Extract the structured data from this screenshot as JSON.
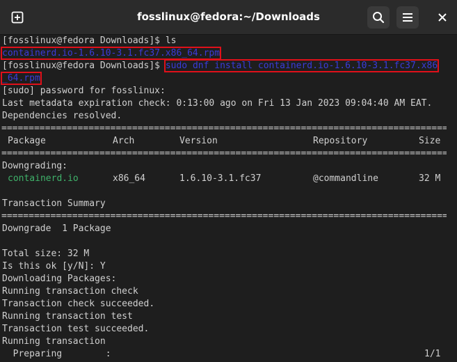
{
  "window": {
    "title": "fosslinux@fedora:~/Downloads",
    "icons": [
      "new-tab-icon",
      "search-icon",
      "hamburger-menu-icon",
      "close-icon"
    ]
  },
  "terminal": {
    "prompt": "[fosslinux@fedora Downloads]$ ",
    "cmd1": "ls",
    "ls_output": "containerd.io-1.6.10-3.1.fc37.x86_64.rpm",
    "cmd2_part1": "sudo dnf install containerd.io-1.6.10-3.1.fc37.x86",
    "cmd2_part2": "_64.rpm",
    "sudo_prompt": "[sudo] password for fosslinux:",
    "metadata": "Last metadata expiration check: 0:13:00 ago on Fri 13 Jan 2023 09:04:40 AM EAT.",
    "deps": "Dependencies resolved.",
    "rule": "================================================================================================",
    "table": {
      "headers": [
        "Package",
        "Arch",
        "Version",
        "Repository",
        "Size"
      ],
      "section": "Downgrading:",
      "rows": [
        {
          "package": "containerd.io",
          "arch": "x86_64",
          "version": "1.6.10-3.1.fc37",
          "repository": "@commandline",
          "size": "32 M"
        }
      ]
    },
    "summary_title": "Transaction Summary",
    "summary_line": "Downgrade  1 Package",
    "total_size": "Total size: 32 M",
    "confirm": "Is this ok [y/N]: Y",
    "downloading": "Downloading Packages:",
    "steps": [
      "Running transaction check",
      "Transaction check succeeded.",
      "Running transaction test",
      "Transaction test succeeded.",
      "Running transaction"
    ],
    "preparing_label": "  Preparing        :",
    "preparing_progress": "1/1"
  },
  "colors": {
    "background": "#1e1e1e",
    "titlebar": "#2b2b2b",
    "text": "#d0d0d0",
    "highlight_text": "#3b3bd8",
    "highlight_box": "#e0101a",
    "package_green": "#3fb26a"
  }
}
